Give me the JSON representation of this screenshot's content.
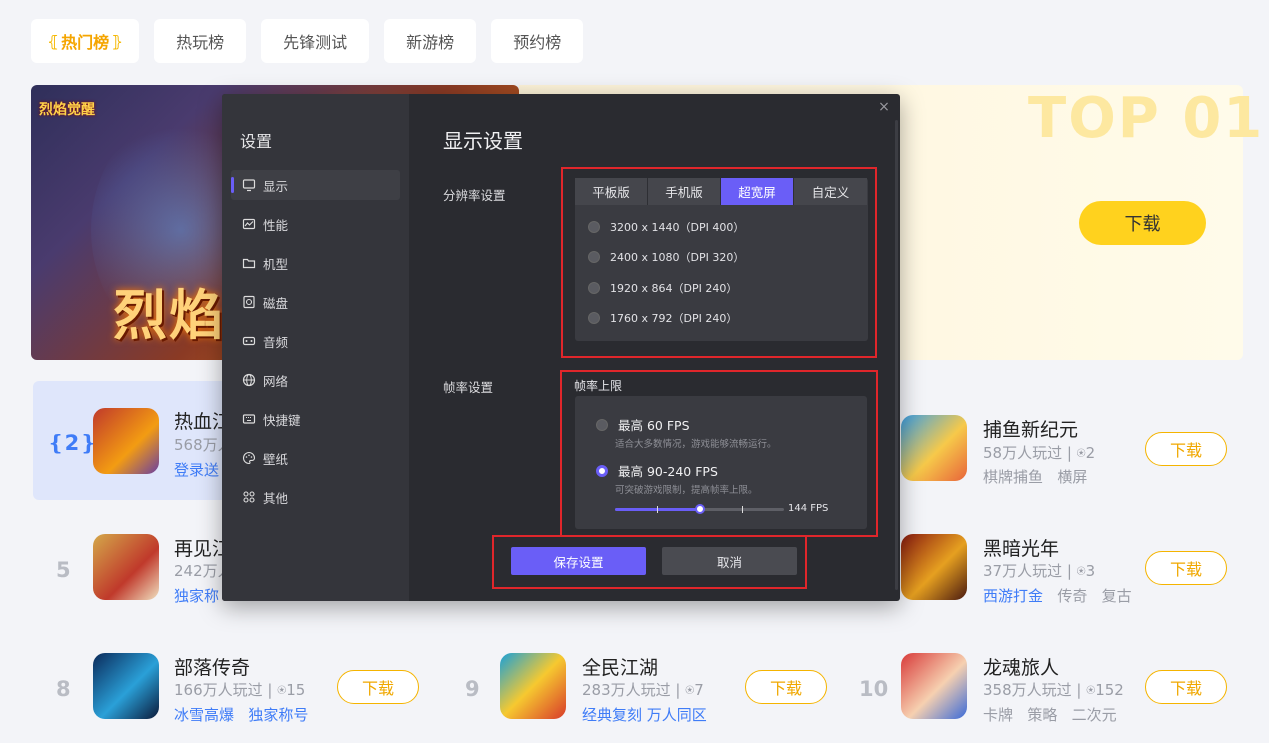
{
  "tabs": [
    {
      "label": "热门榜",
      "active": true
    },
    {
      "label": "热玩榜"
    },
    {
      "label": "先锋测试"
    },
    {
      "label": "新游榜"
    },
    {
      "label": "预约榜"
    }
  ],
  "banner": {
    "small_logo": "烈焰觉醒",
    "big_title": "烈焰觉",
    "top_label": "TOP 01",
    "download_label": "下载"
  },
  "games": [
    {
      "rank": "2",
      "name": "热血江",
      "meta": "568万人",
      "tags": [
        "登录送"
      ],
      "highlight": true
    },
    {
      "rank": "",
      "name": "捕鱼新纪元",
      "meta": "58万人玩过 | ⍟2",
      "tags": [
        "棋牌捕鱼",
        "横屏"
      ],
      "download": "下载"
    },
    {
      "rank": "5",
      "name": "再见江",
      "meta": "242万人",
      "tags": [
        "独家称"
      ]
    },
    {
      "rank": "",
      "name": "黑暗光年",
      "meta": "37万人玩过 | ⍟3",
      "tags": [
        "西游打金",
        "传奇",
        "复古"
      ],
      "download": "下载"
    },
    {
      "rank": "8",
      "name": "部落传奇",
      "meta": "166万人玩过 | ⍟15",
      "tags": [
        "冰雪高爆",
        "独家称号"
      ],
      "download": "下载"
    },
    {
      "rank": "9",
      "name": "全民江湖",
      "meta": "283万人玩过 | ⍟7",
      "tags": [
        "经典复刻 万人同区"
      ],
      "download": "下载"
    },
    {
      "rank": "10",
      "name": "龙魂旅人",
      "meta": "358万人玩过 | ⍟152",
      "tags": [
        "卡牌",
        "策略",
        "二次元"
      ],
      "download": "下载"
    }
  ],
  "modal": {
    "side_title": "设置",
    "side_items": [
      {
        "label": "显示",
        "icon": "monitor-icon",
        "active": true
      },
      {
        "label": "性能",
        "icon": "performance-icon"
      },
      {
        "label": "机型",
        "icon": "device-icon"
      },
      {
        "label": "磁盘",
        "icon": "disk-icon"
      },
      {
        "label": "音频",
        "icon": "audio-icon"
      },
      {
        "label": "网络",
        "icon": "globe-icon"
      },
      {
        "label": "快捷键",
        "icon": "keyboard-icon"
      },
      {
        "label": "壁纸",
        "icon": "palette-icon"
      },
      {
        "label": "其他",
        "icon": "grid-icon"
      }
    ],
    "title": "显示设置",
    "close": "×",
    "resolution_label": "分辨率设置",
    "resolution_tabs": [
      {
        "label": "平板版"
      },
      {
        "label": "手机版"
      },
      {
        "label": "超宽屏",
        "active": true
      },
      {
        "label": "自定义"
      }
    ],
    "resolutions": [
      "3200 x 1440（DPI 400）",
      "2400 x 1080（DPI 320）",
      "1920 x 864（DPI 240）",
      "1760 x 792（DPI 240）"
    ],
    "fps_label": "帧率设置",
    "fps_title": "帧率上限",
    "fps_options": [
      {
        "label": "最高 60 FPS",
        "desc": "适合大多数情况，游戏能够流畅运行。",
        "selected": false
      },
      {
        "label": "最高 90-240 FPS",
        "desc": "可突破游戏限制，提高帧率上限。",
        "selected": true
      }
    ],
    "fps_value": "144 FPS",
    "fps_slider_fraction": 0.5,
    "save_label": "保存设置",
    "cancel_label": "取消"
  },
  "colors": {
    "accent": "#6a5ef7",
    "highlight": "#e0262b",
    "gold": "#f5b400",
    "link": "#3f7cf7"
  }
}
